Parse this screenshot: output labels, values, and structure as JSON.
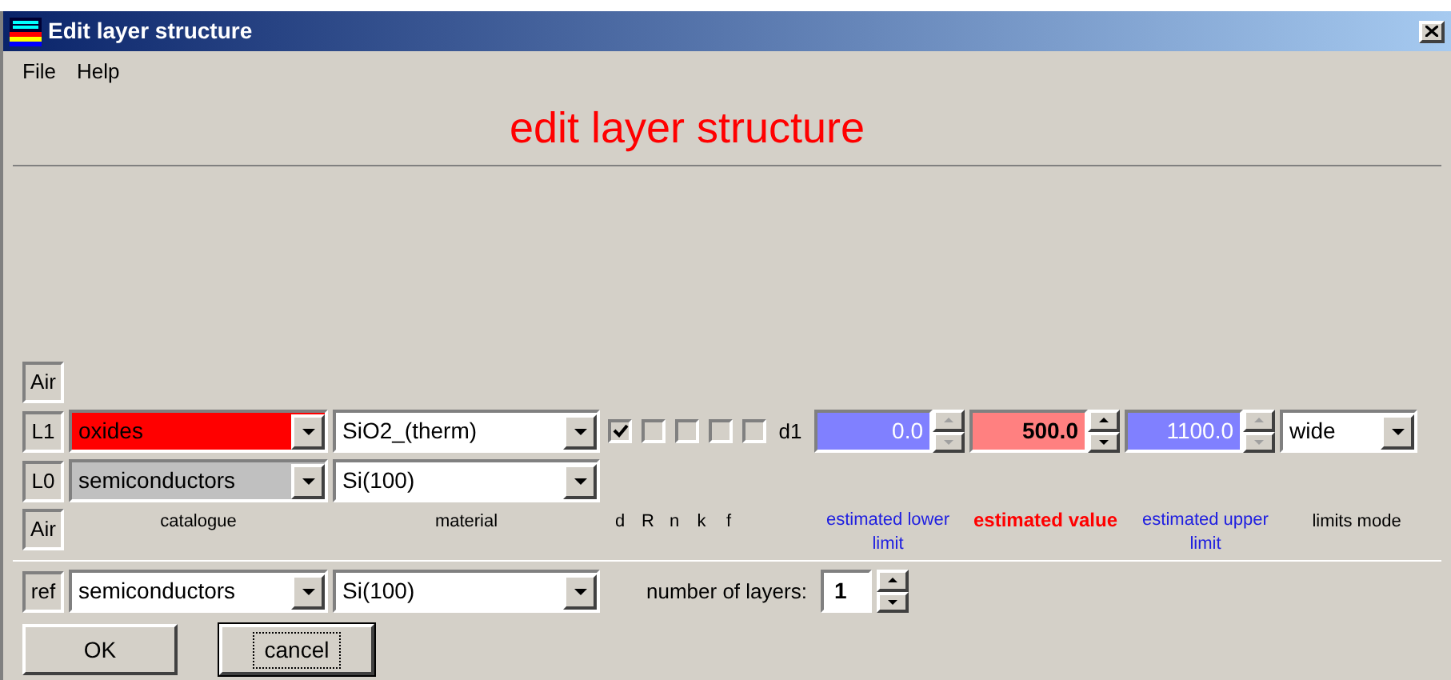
{
  "window": {
    "title": "Edit layer structure"
  },
  "menu": [
    "File",
    "Help"
  ],
  "heading": "edit layer structure",
  "layers": [
    {
      "kind": "ambient",
      "label": "Air"
    },
    {
      "kind": "layer",
      "label": "L1",
      "catalogue": {
        "value": "oxides",
        "color": "#ff0000"
      },
      "material": "SiO2_(therm)",
      "fit": [
        {
          "checked": true
        },
        {
          "checked": false
        },
        {
          "checked": false
        },
        {
          "checked": false
        },
        {
          "checked": false
        }
      ],
      "parameter": "d1",
      "lower": {
        "value": "0.0",
        "disabled": true
      },
      "estimate": {
        "value": "500.0",
        "disabled": false
      },
      "upper": {
        "value": "1100.0",
        "disabled": true
      },
      "limits_mode": "wide"
    },
    {
      "kind": "substrate",
      "label": "L0",
      "catalogue": {
        "value": "semiconductors",
        "color": "#c0c0c0"
      },
      "material": "Si(100)"
    }
  ],
  "bottom_label": "Air",
  "column_headers": {
    "catalogue": "catalogue",
    "material": "material",
    "fit": [
      "d",
      "R",
      "n",
      "k",
      "f"
    ],
    "lower": "estimated lower limit",
    "estimate": "estimated value",
    "upper": "estimated upper limit",
    "limits_mode": "limits mode"
  },
  "reference": {
    "label": "ref",
    "catalogue": "semiconductors",
    "material": "Si(100)",
    "layers_label": "number of layers:",
    "layers_count": "1"
  },
  "buttons": [
    {
      "label": "OK",
      "focused": false
    },
    {
      "label": "cancel",
      "focused": true
    }
  ]
}
